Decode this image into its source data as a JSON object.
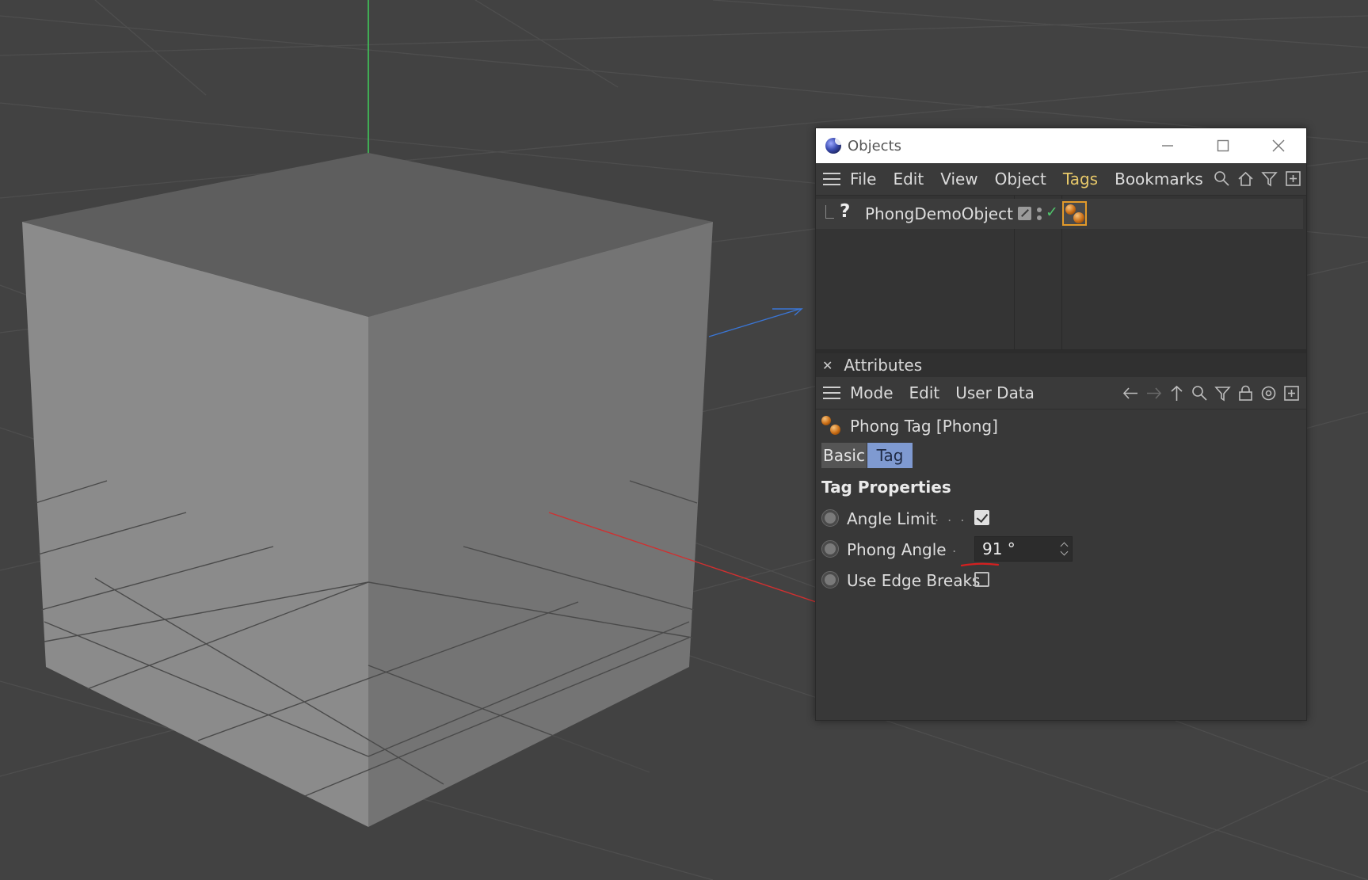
{
  "objects_window": {
    "title": "Objects",
    "menu": [
      "File",
      "Edit",
      "View",
      "Object",
      "Tags",
      "Bookmarks"
    ],
    "active_menu": "Tags",
    "object_row": {
      "icon": "question-mark-icon",
      "name": "PhongDemoObject",
      "visibility_check": "✓"
    }
  },
  "attributes": {
    "panel_title": "Attributes",
    "menu": [
      "Mode",
      "Edit",
      "User Data"
    ],
    "tag_title": "Phong Tag [Phong]",
    "tabs": [
      "Basic",
      "Tag"
    ],
    "active_tab": "Tag",
    "section_title": "Tag Properties",
    "properties": [
      {
        "label": "Angle Limit",
        "dots": ". . .",
        "type": "checkbox",
        "checked": true
      },
      {
        "label": "Phong Angle",
        "dots": ". .",
        "type": "number",
        "value": "91 °"
      },
      {
        "label": "Use Edge Breaks",
        "dots": "",
        "type": "checkbox",
        "checked": false
      }
    ]
  },
  "colors": {
    "accent_tags": "#e8c96a",
    "tab_active": "#7f9ad1",
    "tag_highlight": "#e39a2a",
    "axis_y": "#3fcf5a",
    "axis_x": "#d03030",
    "axis_z": "#3a76d6",
    "annotation": "#d42020"
  },
  "icons": [
    "cinema4d-logo-icon",
    "minimize-icon",
    "maximize-icon",
    "close-icon",
    "search-icon",
    "home-icon",
    "filter-icon",
    "new-panel-icon",
    "back-arrow-icon",
    "forward-arrow-icon",
    "up-arrow-icon",
    "lock-icon",
    "target-icon",
    "phong-tag-icon"
  ]
}
